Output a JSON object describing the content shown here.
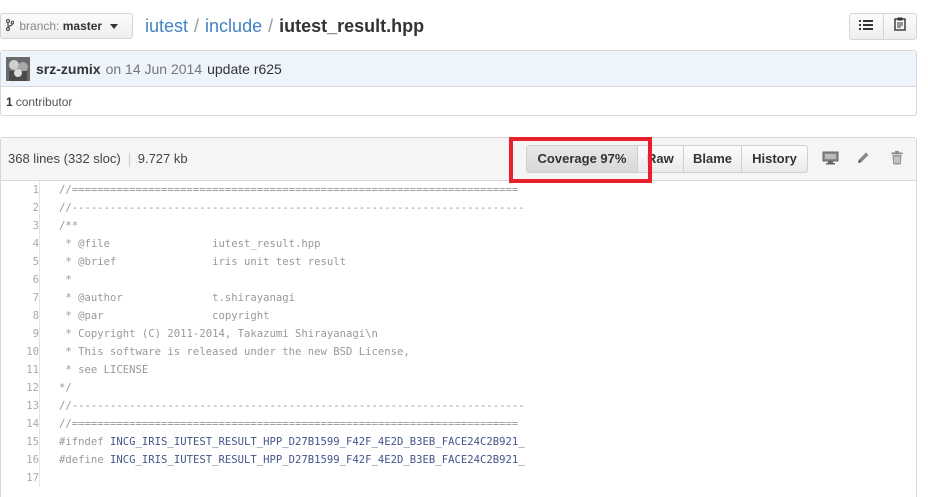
{
  "branch": {
    "label": "branch:",
    "name": "master"
  },
  "breadcrumb": {
    "repo": "iutest",
    "folder": "include",
    "separator": "/",
    "file": "iutest_result.hpp"
  },
  "toolbar": {
    "icons": [
      "list-icon",
      "clipboard-icon"
    ]
  },
  "commit": {
    "author": "srz-zumix",
    "date_text": "on 14 Jun 2014",
    "message": "update r625",
    "contributors_count": "1",
    "contributors_label": "contributor"
  },
  "file": {
    "lines_info": "368 lines (332 sloc)",
    "size": "9.727 kb",
    "buttons": {
      "coverage": "Coverage 97%",
      "raw": "Raw",
      "blame": "Blame",
      "history": "History"
    },
    "icons": [
      "desktop-icon",
      "pencil-icon",
      "trash-icon"
    ],
    "highlight_color": "#e8202a"
  },
  "code_lines": [
    {
      "num": "1",
      "text": "//======================================================================"
    },
    {
      "num": "2",
      "text": "//-----------------------------------------------------------------------"
    },
    {
      "num": "3",
      "text": "/**"
    },
    {
      "num": "4",
      "text": " * @file                iutest_result.hpp"
    },
    {
      "num": "5",
      "text": " * @brief               iris unit test result"
    },
    {
      "num": "6",
      "text": " *"
    },
    {
      "num": "7",
      "text": " * @author              t.shirayanagi"
    },
    {
      "num": "8",
      "text": " * @par                 copyright"
    },
    {
      "num": "9",
      "text": " * Copyright (C) 2011-2014, Takazumi Shirayanagi\\n"
    },
    {
      "num": "10",
      "text": " * This software is released under the new BSD License,"
    },
    {
      "num": "11",
      "text": " * see LICENSE"
    },
    {
      "num": "12",
      "text": "*/"
    },
    {
      "num": "13",
      "text": "//-----------------------------------------------------------------------"
    },
    {
      "num": "14",
      "text": "//======================================================================"
    },
    {
      "num": "15",
      "directive": "#ifndef",
      "rest": " INCG_IRIS_IUTEST_RESULT_HPP_D27B1599_F42F_4E2D_B3EB_FACE24C2B921_"
    },
    {
      "num": "16",
      "directive": "#define",
      "rest": " INCG_IRIS_IUTEST_RESULT_HPP_D27B1599_F42F_4E2D_B3EB_FACE24C2B921_"
    },
    {
      "num": "17",
      "text": ""
    }
  ]
}
